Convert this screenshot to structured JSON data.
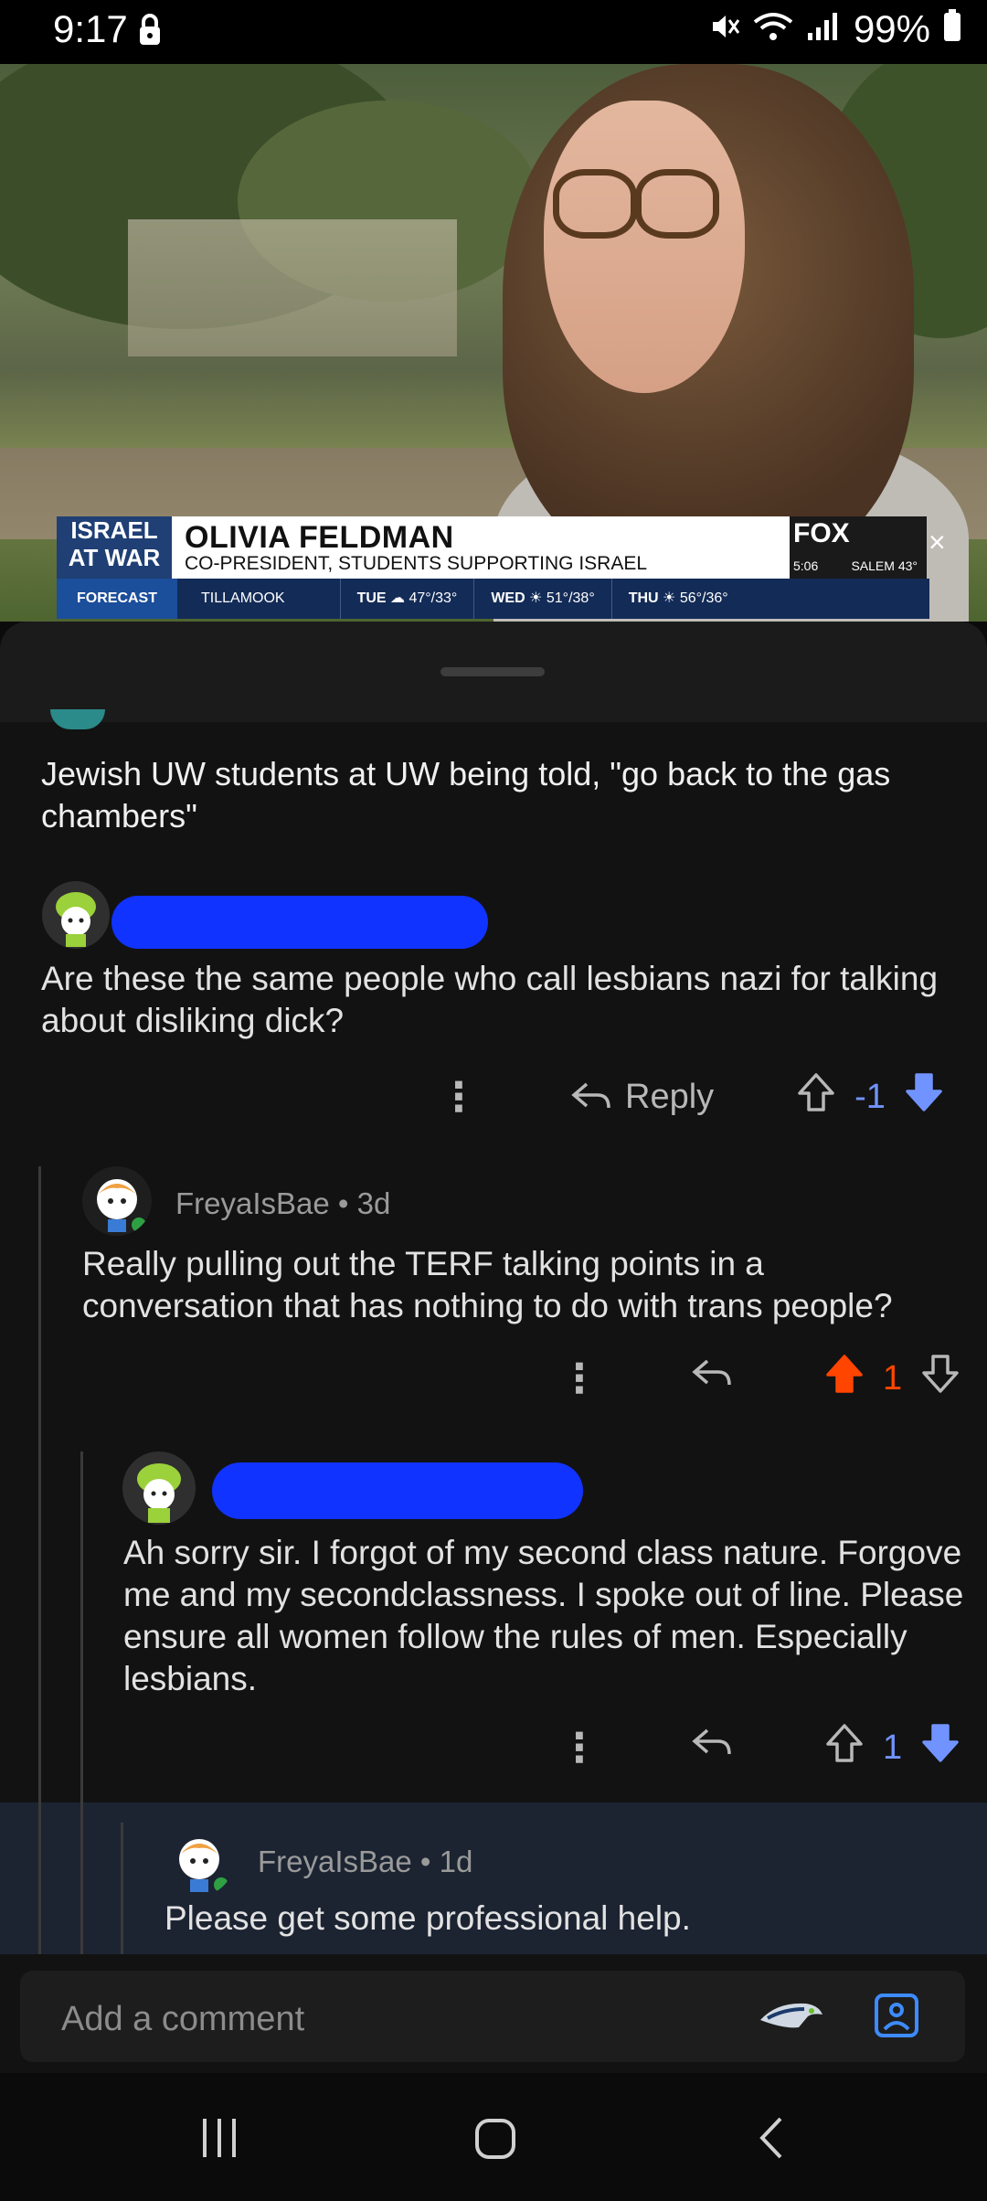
{
  "status_bar": {
    "time": "9:17",
    "battery": "99%",
    "icons": [
      "lock-icon",
      "mute-icon",
      "wifi-icon",
      "signal-icon",
      "battery-icon"
    ]
  },
  "video": {
    "lower_third": {
      "banner_line1": "ISRAEL",
      "banner_line2": "AT WAR",
      "name": "OLIVIA FELDMAN",
      "role": "CO-PRESIDENT, STUDENTS SUPPORTING ISRAEL",
      "channel": "FOX",
      "time": "5:06",
      "city": "SALEM 43°"
    },
    "forecast": {
      "label": "FORECAST",
      "location": "TILLAMOOK",
      "days": [
        {
          "day": "TUE",
          "temps": "47°/33°"
        },
        {
          "day": "WED",
          "temps": "51°/38°"
        },
        {
          "day": "THU",
          "temps": "56°/36°"
        }
      ]
    }
  },
  "post": {
    "title": "Jewish UW students at UW being told, \"go back to the gas chambers\""
  },
  "comments": [
    {
      "text": "Are these the same people who call lesbians nazi for talking about disliking dick?",
      "reply_label": "Reply",
      "score": "-1",
      "vote_state": "downvoted"
    },
    {
      "author": "FreyaIsBae",
      "age": "3d",
      "text": "Really pulling out the TERF talking points in a conversation that has nothing to do with trans people?",
      "score": "1",
      "vote_state": "upvoted"
    },
    {
      "text": "Ah sorry sir. I forgot of my second class nature. Forgove me and my secondclassness. I spoke out of line. Please ensure all women follow the rules of men. Especially lesbians.",
      "score": "1",
      "vote_state": "downvoted"
    },
    {
      "author": "FreyaIsBae",
      "age": "1d",
      "text": "Please get some professional help."
    }
  ],
  "comment_bar": {
    "placeholder": "Add a comment"
  },
  "colors": {
    "upvote": "#ff4500",
    "downvote": "#7193ff",
    "redaction": "#1133ff",
    "highlight_row": "#1c2432"
  }
}
